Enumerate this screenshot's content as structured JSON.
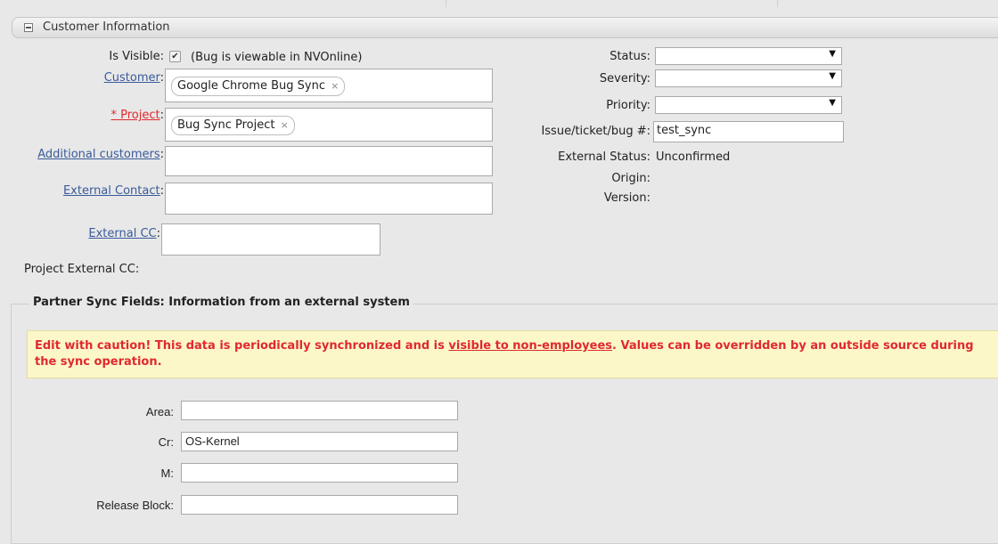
{
  "section": {
    "title": "Customer Information"
  },
  "left": {
    "is_visible_label": "Is Visible:",
    "is_visible_note": "(Bug is viewable in NVOnline)",
    "customer_label": "Customer",
    "customer_token": "Google Chrome Bug Sync",
    "project_label": "* Project",
    "project_token": "Bug Sync Project",
    "additional_customers_label": "Additional customers",
    "external_contact_label": "External Contact",
    "external_cc_label": "External CC",
    "project_external_cc_label": "Project External CC:",
    "colon": ":"
  },
  "right": {
    "status_label": "Status:",
    "severity_label": "Severity:",
    "priority_label": "Priority:",
    "issue_label": "Issue/ticket/bug #:",
    "issue_value": "test_sync",
    "external_status_label": "External Status:",
    "external_status_value": "Unconfirmed",
    "origin_label": "Origin:",
    "version_label": "Version:"
  },
  "partner": {
    "legend": "Partner Sync Fields: Information from an external system",
    "warn_prefix": "Edit with caution! This data is periodically synchronized and is ",
    "warn_link": "visible to non-employees",
    "warn_suffix": ". Values can be overridden by an outside source during the sync operation.",
    "area_label": "Area:",
    "area_value": "",
    "cr_label": "Cr:",
    "cr_value": "OS-Kernel",
    "m_label": "M:",
    "m_value": "",
    "release_block_label": "Release Block:",
    "release_block_value": ""
  },
  "glyphs": {
    "token_remove": "×",
    "dropdown_arrow": "▼",
    "checkmark": "✔"
  },
  "colors": {
    "required": "#e0292f",
    "link": "#3a5a9a",
    "warning_bg": "#fbf7c9"
  }
}
